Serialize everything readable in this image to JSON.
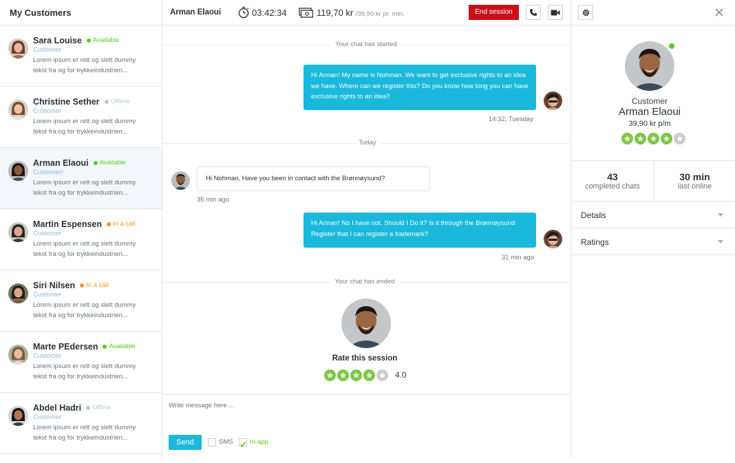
{
  "customers_panel": {
    "title": "My Customers",
    "items": [
      {
        "name": "Sara Louise",
        "status": "Available",
        "status_color": "#5ccb1f",
        "role": "Customer",
        "preview": "Lorem ipsum er rett og slett dummy tekst fra og for trykkeindustrien..."
      },
      {
        "name": "Christine Sether",
        "status": "Offline",
        "status_color": "#b7c9d6",
        "role": "Customer",
        "preview": "Lorem ipsum er rett og slett dummy tekst fra og for trykkeindustrien..."
      },
      {
        "name": "Arman Elaoui",
        "status": "Available",
        "status_color": "#5ccb1f",
        "role": "Customerr",
        "preview": "Lorem ipsum er rett og slett dummy tekst fra og for trykkeindustrien..."
      },
      {
        "name": "Martin Espensen",
        "status": "In a call",
        "status_color": "#f29a16",
        "role": "Customer",
        "preview": "Lorem ipsum er rett og slett dummy tekst fra og for trykkeindustrien..."
      },
      {
        "name": "Siri Nilsen",
        "status": "In a call",
        "status_color": "#f29a16",
        "role": "Customer",
        "preview": "Lorem ipsum er rett og slett dummy tekst fra og for trykkeindustrien..."
      },
      {
        "name": "Marte PEdersen",
        "status": "Available",
        "status_color": "#5ccb1f",
        "role": "Customer",
        "preview": "Lorem ipsum er rett og slett dummy tekst fra og for trykkeindustrien..."
      },
      {
        "name": "Abdel Hadri",
        "status": "Offline",
        "status_color": "#b7c9d6",
        "role": "Customer",
        "preview": "Lorem ipsum er rett og slett dummy tekst fra og for trykkeindustrien..."
      }
    ]
  },
  "session_bar": {
    "contact_name": "Arman Elaoui",
    "timer": "03:42:34",
    "price": "119,70 kr",
    "rate": "/39,90 kr pr. min.",
    "end_label": "End session",
    "timer_icon": "stopwatch-icon",
    "money_icon": "money-icon",
    "phone_icon": "phone-icon",
    "video_icon": "video-camera-icon"
  },
  "chat": {
    "started_label": "Your chat has started",
    "msg1": "Hi Arman! My name is Nohman. We want to get exclusive rights to an idea we have. Where can we register this? Do you know how long you can have exclusive rights to an idea?",
    "msg1_time": "14:32, Tuesday",
    "today_label": "Today",
    "msg2": "Hi Nohman, Have you been in contact with the Brønnøysund?",
    "msg2_time": "35 min ago",
    "msg3": "Hi Arman! No I have not. Should I Do it? Is it through the Brønnøysund Register that I can register a trademark?",
    "msg3_time": "31 min ago",
    "ended_label": "Your chat has ended",
    "rate_title": "Rate this session",
    "rating": 4,
    "rating_label": "4.0"
  },
  "composer": {
    "placeholder": "Write message here....",
    "send_label": "Send",
    "sms_label": "SMS",
    "sms_checked": false,
    "inapp_label": "In-app",
    "inapp_checked": true
  },
  "profile": {
    "role": "Customer",
    "name": "Arman Elaoui",
    "price": "39,90 kr p/m",
    "rating": 4,
    "completed_chats": "43",
    "completed_label": "completed chats",
    "last_online": "30 min",
    "last_online_label": "last online",
    "sections": [
      "Details",
      "Ratings"
    ],
    "gear_icon": "gear-icon",
    "close_icon": "close-icon"
  },
  "colors": {
    "accent": "#1ab9dc",
    "danger": "#c8101b",
    "available": "#5ccb1f",
    "in_call": "#f29a16",
    "offline": "#b7c9d6",
    "star_on": "#7ac943",
    "star_off": "#c9cdd1"
  }
}
